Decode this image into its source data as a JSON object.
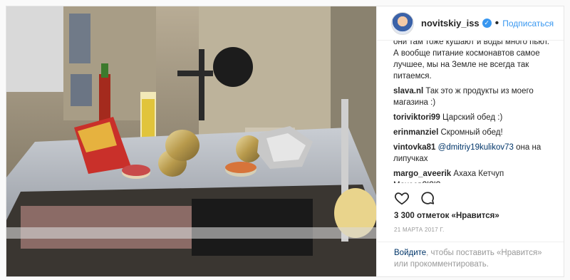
{
  "post": {
    "username": "novitskiy_iss",
    "verified_mark": "✓",
    "separator": "•",
    "follow_label": "Подписаться",
    "caption_tail": "они там тоже кушают и воды много пьют. А вообще питание космонавтов самое лучшее, мы на Земле не всегда так питаемся.",
    "comments": [
      {
        "user": "slava.nl",
        "text": "Так это ж продукты из моего магазина :)"
      },
      {
        "user": "toriviktori99",
        "text": "Царский обед :)"
      },
      {
        "user": "erinmanziel",
        "text": "Скромный обед!"
      },
      {
        "user": "vintovka81",
        "mention": "@dmitriy19kulikov73",
        "text": "она на липучках"
      },
      {
        "user": "margo_aveerik",
        "text": "Ахаха Кетчуп Махеев?!?!?"
      }
    ],
    "likes": "3 300 отметок «Нравится»",
    "date": "21 МАРТА 2017 Г.",
    "login_link": "Войдите",
    "login_rest": ", чтобы поставить «Нравится» или прокомментировать."
  },
  "icons": {
    "like": "heart-icon",
    "comment": "comment-bubble-icon",
    "verified": "verified-badge-icon"
  },
  "colors": {
    "accent": "#3897f0",
    "link": "#003569",
    "muted": "#999999"
  }
}
